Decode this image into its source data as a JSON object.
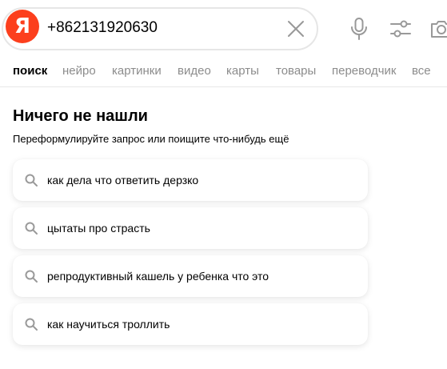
{
  "search": {
    "logo_letter": "Я",
    "query": "+862131920630"
  },
  "tabs": [
    {
      "label": "поиск",
      "active": true
    },
    {
      "label": "нейро"
    },
    {
      "label": "картинки"
    },
    {
      "label": "видео"
    },
    {
      "label": "карты"
    },
    {
      "label": "товары"
    },
    {
      "label": "переводчик"
    },
    {
      "label": "все"
    }
  ],
  "no_results": {
    "title": "Ничего не нашли",
    "subtitle": "Переформулируйте запрос или поищите что-нибудь ещё"
  },
  "suggestions": [
    "как дела что ответить дерзко",
    "цытаты про страсть",
    "репродуктивный кашель у ребенка что это",
    "как научиться троллить"
  ],
  "icons": {
    "logo": "yandex-logo",
    "clear": "close-icon",
    "voice": "microphone-icon",
    "filters": "settings-sliders-icon",
    "camera": "camera-icon",
    "suggestion": "search-icon"
  },
  "colors": {
    "brand": "#fc3f1d",
    "tab_inactive": "#8c8c8c",
    "icon_gray": "#999999"
  }
}
